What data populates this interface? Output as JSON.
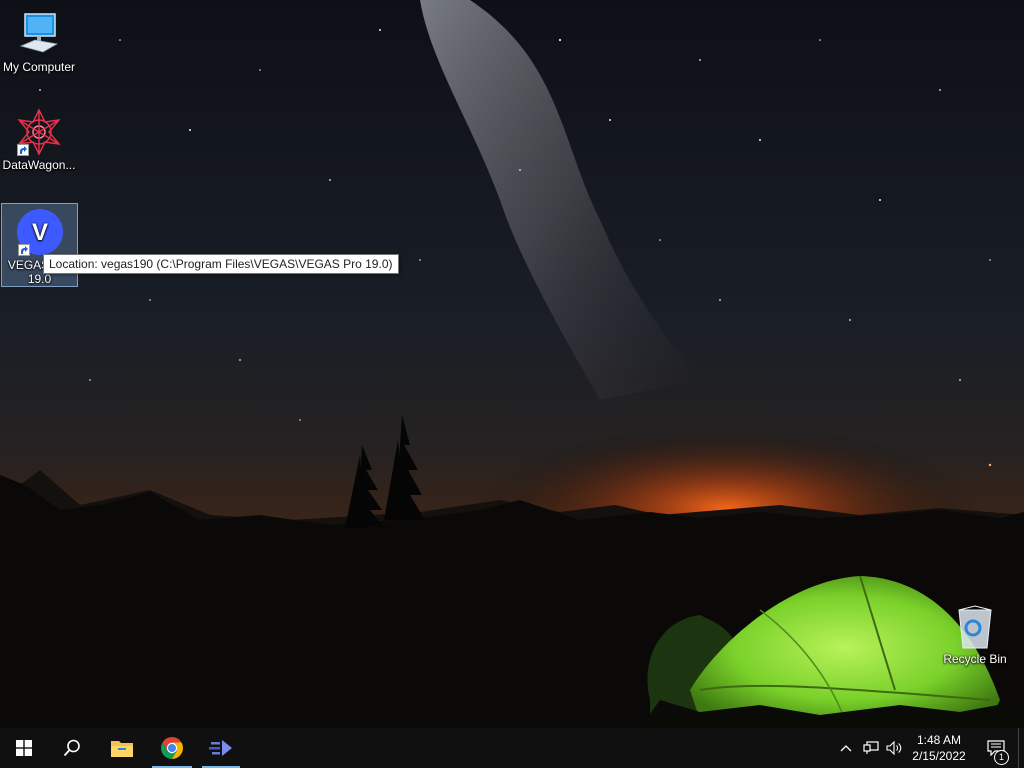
{
  "desktop": {
    "icons": [
      {
        "label": "My Computer"
      },
      {
        "label": "DataWagon..."
      },
      {
        "label": "VEGAS Pro 19.0"
      },
      {
        "label": "Recycle Bin"
      }
    ],
    "vegas_letter": "V",
    "tooltip": "Location: vegas190 (C:\\Program Files\\VEGAS\\VEGAS Pro 19.0)"
  },
  "taskbar": {
    "pinned": [
      "start-icon",
      "search-icon",
      "file-explorer-icon",
      "chrome-icon",
      "app-icon"
    ],
    "clock": {
      "time": "1:48 AM",
      "date": "2/15/2022"
    },
    "notifications_count": "1"
  },
  "colors": {
    "taskbar": "#101010",
    "accent": "#76b9ed",
    "vegas_blue": "#3d5afe",
    "tent_green": "#7ad12a"
  }
}
